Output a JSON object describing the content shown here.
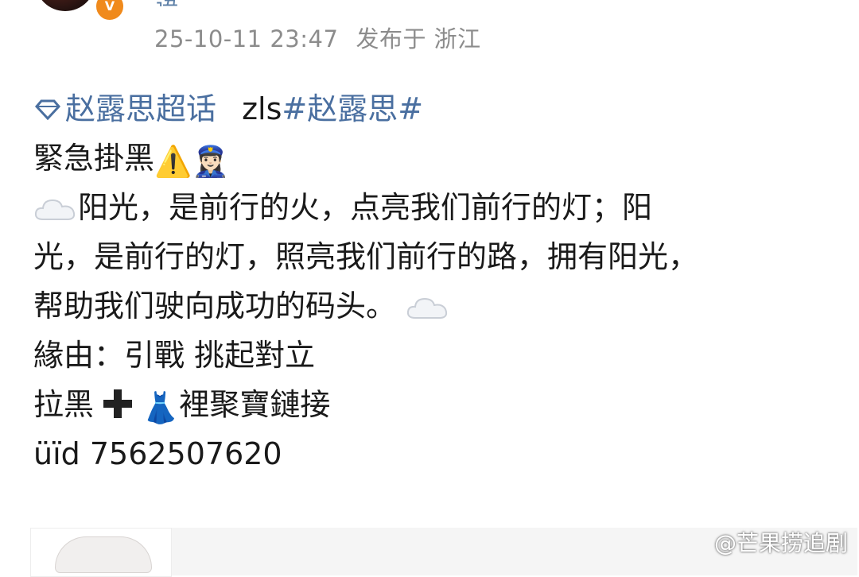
{
  "author": {
    "name": "语",
    "verified": true
  },
  "meta": {
    "timestamp": "25-10-11 23:47",
    "location_label": "发布于 浙江"
  },
  "post": {
    "topic": "赵露思超话",
    "prefix": "zls",
    "hashtag": "#赵露思#",
    "headline": "緊急掛黑",
    "lines": [
      "阳光，是前行的火，点亮我们前行的灯；阳",
      "光，是前行的灯，照亮我们前行的路，拥有阳光，",
      "帮助我们驶向成功的码头。"
    ],
    "reason": "緣由：引戰 挑起對立",
    "block_prefix": "拉黑",
    "block_suffix": "裡聚寶鏈接",
    "uid": "üïd 7562507620",
    "emojis": {
      "warning": "⚠️",
      "police": "👮🏻‍♀️",
      "dress": "👗"
    }
  },
  "watermark": "@芒果捞追剧",
  "colors": {
    "link": "#4a6fa0",
    "meta": "#8c8c8c",
    "verified": "#f08a1c"
  }
}
